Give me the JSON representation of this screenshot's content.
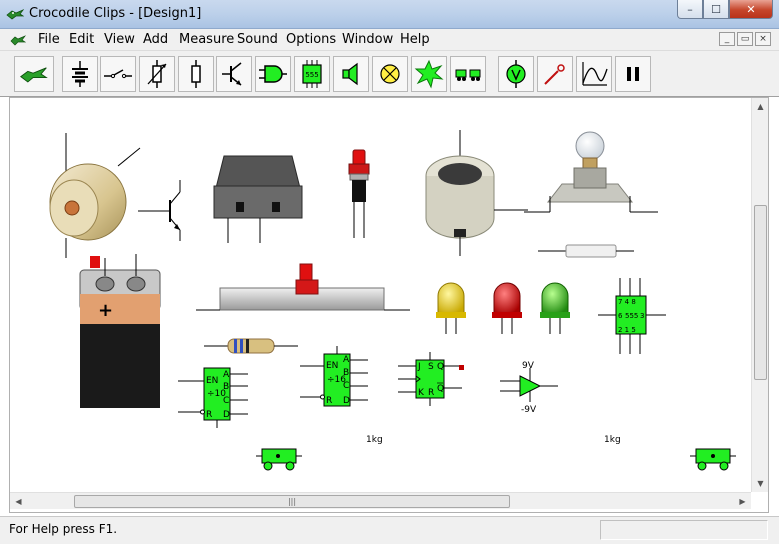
{
  "window": {
    "title": "Crocodile Clips - [Design1]",
    "buttons": {
      "minimize": "–",
      "maximize": "☐",
      "close": "✕"
    }
  },
  "menu": {
    "items": [
      "File",
      "Edit",
      "View",
      "Add",
      "Measure",
      "Sound",
      "Options",
      "Window",
      "Help"
    ],
    "mdi_buttons": [
      "_",
      "▭",
      "×"
    ]
  },
  "toolbar": {
    "buttons": [
      "crocodile-icon",
      "battery-icon",
      "switch-icon",
      "variable-resistor-icon",
      "resistor-icon",
      "transistor-icon",
      "logic-gate-icon",
      "ic-555-icon",
      "speaker-icon",
      "lamp-icon",
      "spark-icon",
      "trolley-icon",
      "voltmeter-icon",
      "probe-icon",
      "graph-icon",
      "pause-icon"
    ],
    "ic_555_label": "555"
  },
  "canvas": {
    "labels": {
      "counter1_en": "EN",
      "counter1_a": "A",
      "counter1_b": "B",
      "counter1_div": "÷10",
      "counter1_c": "C",
      "counter1_r": "R",
      "counter1_d": "D",
      "counter2_en": "EN",
      "counter2_a": "A",
      "counter2_b": "B",
      "counter2_div": "÷16",
      "counter2_c": "C",
      "counter2_r": "R",
      "counter2_d": "D",
      "ff_j": "J",
      "ff_s": "S",
      "ff_q": "Q",
      "ff_qbar": "Q",
      "ff_k": "K",
      "ff_r": "R",
      "opamp_top": "9V",
      "opamp_bottom": "-9V",
      "ic555_pins_top": "7  4  8",
      "ic555_mid_left": "6",
      "ic555_mid": "555",
      "ic555_mid_right": "3",
      "ic555_pins_bottom": "2  1  5",
      "mass1": "1kg",
      "mass2": "1kg",
      "battery_plus": "+"
    }
  },
  "scrollbars": {
    "h_thumb_grip": "|||"
  },
  "status": {
    "text": "For Help press F1."
  },
  "colors": {
    "chip_green": "#22ee22",
    "led_yellow": "#e8d000",
    "led_red": "#e00000",
    "led_green": "#30c020",
    "switch_red": "#e01010",
    "battery_copper": "#e2a070",
    "battery_black": "#1a1a1a"
  }
}
